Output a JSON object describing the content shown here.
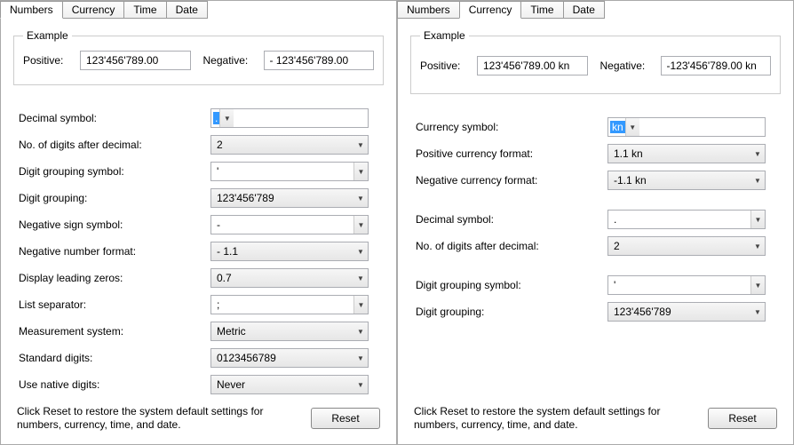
{
  "left": {
    "tabs": {
      "numbers": "Numbers",
      "currency": "Currency",
      "time": "Time",
      "date": "Date"
    },
    "example": {
      "legend": "Example",
      "positive_label": "Positive:",
      "positive_value": "123'456'789.00",
      "negative_label": "Negative:",
      "negative_value": "- 123'456'789.00"
    },
    "rows": {
      "decimal_symbol": {
        "label": "Decimal symbol:",
        "value": "."
      },
      "digits_after_decimal": {
        "label": "No. of digits after decimal:",
        "value": "2"
      },
      "digit_grouping_symbol": {
        "label": "Digit grouping symbol:",
        "value": "'"
      },
      "digit_grouping": {
        "label": "Digit grouping:",
        "value": "123'456'789"
      },
      "negative_sign_symbol": {
        "label": "Negative sign symbol:",
        "value": "-"
      },
      "negative_number_format": {
        "label": "Negative number format:",
        "value": "- 1.1"
      },
      "display_leading_zeros": {
        "label": "Display leading zeros:",
        "value": "0.7"
      },
      "list_separator": {
        "label": "List separator:",
        "value": ";"
      },
      "measurement_system": {
        "label": "Measurement system:",
        "value": "Metric"
      },
      "standard_digits": {
        "label": "Standard digits:",
        "value": "0123456789"
      },
      "use_native_digits": {
        "label": "Use native digits:",
        "value": "Never"
      }
    },
    "footer": {
      "text": "Click Reset to restore the system default settings for numbers, currency, time, and date.",
      "reset": "Reset"
    }
  },
  "right": {
    "tabs": {
      "numbers": "Numbers",
      "currency": "Currency",
      "time": "Time",
      "date": "Date"
    },
    "example": {
      "legend": "Example",
      "positive_label": "Positive:",
      "positive_value": "123'456'789.00 kn",
      "negative_label": "Negative:",
      "negative_value": "-123'456'789.00 kn"
    },
    "rows": {
      "currency_symbol": {
        "label": "Currency symbol:",
        "value": "kn"
      },
      "positive_currency_format": {
        "label": "Positive currency format:",
        "value": "1.1 kn"
      },
      "negative_currency_format": {
        "label": "Negative currency format:",
        "value": "-1.1 kn"
      },
      "decimal_symbol": {
        "label": "Decimal symbol:",
        "value": "."
      },
      "digits_after_decimal": {
        "label": "No. of digits after decimal:",
        "value": "2"
      },
      "digit_grouping_symbol": {
        "label": "Digit grouping symbol:",
        "value": "'"
      },
      "digit_grouping": {
        "label": "Digit grouping:",
        "value": "123'456'789"
      }
    },
    "footer": {
      "text": "Click Reset to restore the system default settings for numbers, currency, time, and date.",
      "reset": "Reset"
    }
  }
}
